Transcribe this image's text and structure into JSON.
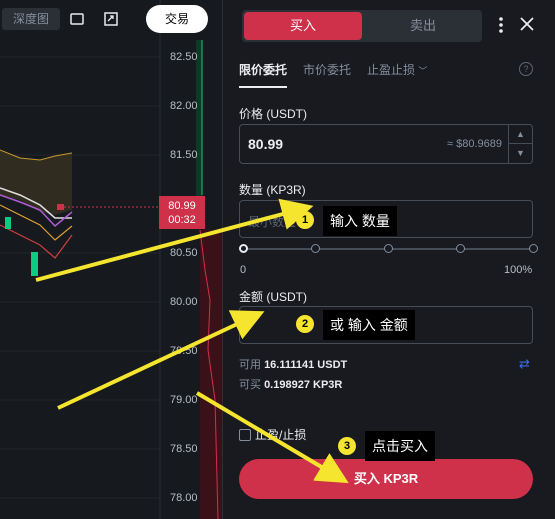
{
  "toolbar": {
    "depth_label": "深度图",
    "trade_label": "交易"
  },
  "chart": {
    "price_ticks": [
      "82.50",
      "82.00",
      "81.50",
      "81.00",
      "80.50",
      "80.00",
      "79.50",
      "79.00",
      "78.50",
      "78.00"
    ],
    "current_price": "80.99",
    "countdown": "00:32"
  },
  "order_panel": {
    "buy_label": "买入",
    "sell_label": "卖出",
    "tabs": [
      "限价委托",
      "市价委托",
      "止盈止损"
    ],
    "price_label": "价格 (USDT)",
    "price_value": "80.99",
    "price_approx": "≈ $80.9689",
    "quantity_label": "数量 (KP3R)",
    "quantity_placeholder": "最小数量",
    "slider_min": "0",
    "slider_max": "100%",
    "amount_label": "金额 (USDT)",
    "available_label": "可用",
    "available_value": "16.111141 USDT",
    "can_buy_label": "可买",
    "can_buy_value": "0.198927 KP3R",
    "tpsl_label": "止盈/止损",
    "buy_button": "买入 KP3R"
  },
  "annotations": [
    {
      "step": "1",
      "text": "输入 数量"
    },
    {
      "step": "2",
      "text": "或 输入 金额"
    },
    {
      "step": "3",
      "text": "点击买入"
    }
  ],
  "colors": {
    "buy": "#cf304a",
    "accent_yellow": "#f5e52f",
    "up": "#0ecb81",
    "bg": "#181a20"
  }
}
